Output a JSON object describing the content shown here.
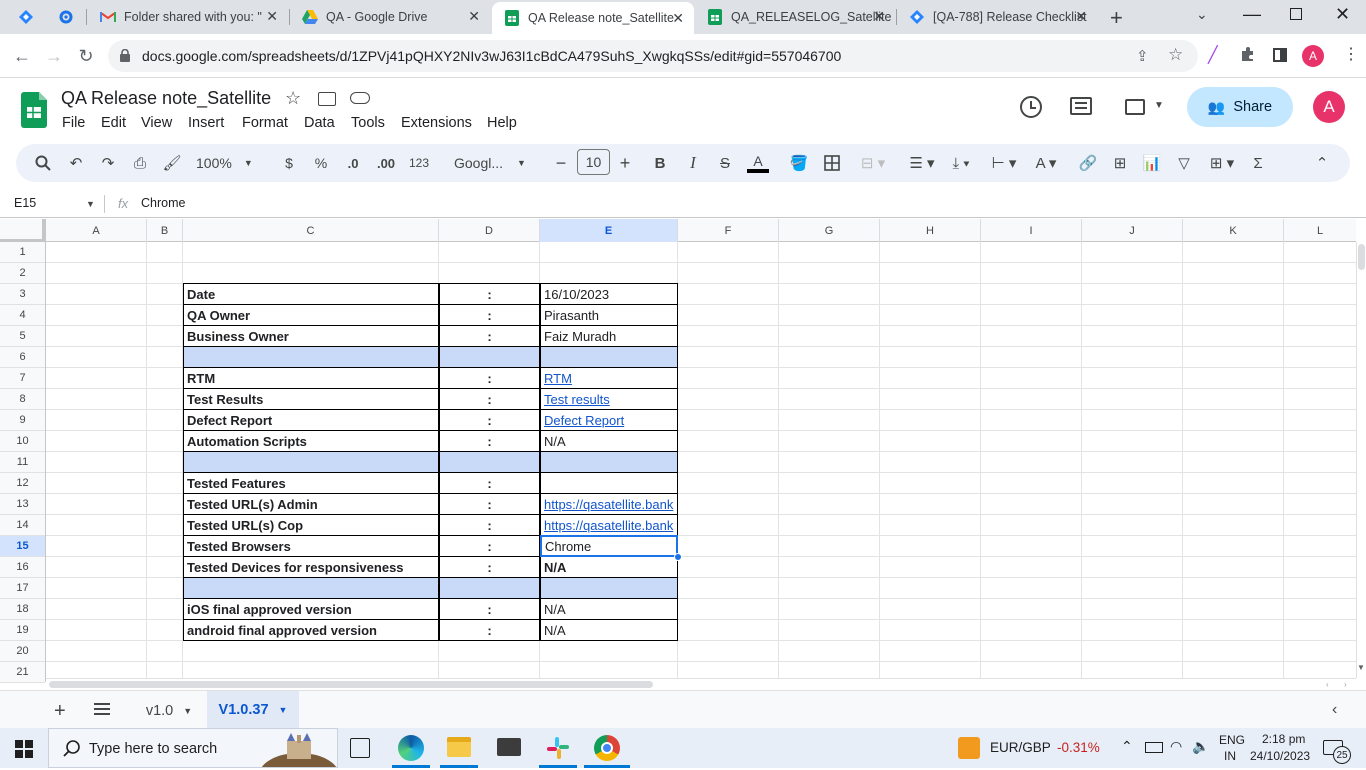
{
  "browser": {
    "tabs": [
      {
        "title": "Folder shared with you: \"",
        "icon": "gmail-icon"
      },
      {
        "title": "QA - Google Drive",
        "icon": "drive-icon"
      },
      {
        "title": "QA Release note_Satellite",
        "icon": "sheets-icon",
        "active": true
      },
      {
        "title": "QA_RELEASELOG_Satellite",
        "icon": "sheets-icon"
      },
      {
        "title": "[QA-788] Release Checklist",
        "icon": "jira-icon"
      }
    ],
    "url": "docs.google.com/spreadsheets/d/1ZPVj41pQHXY2NIv3wJ63I1cBdCA479SuhS_XwgkqSSs/edit#gid=557046700",
    "profile_initial": "A"
  },
  "doc": {
    "title": "QA Release note_Satellite",
    "menus": [
      "File",
      "Edit",
      "View",
      "Insert",
      "Format",
      "Data",
      "Tools",
      "Extensions",
      "Help"
    ],
    "share_label": "Share",
    "avatar_initial": "A"
  },
  "toolbar": {
    "zoom": "100%",
    "currency": "$",
    "percent": "%",
    "dec_decrease": ".0",
    "dec_increase": ".00",
    "number_format": "123",
    "font": "Googl...",
    "font_size": "10"
  },
  "formula_bar": {
    "cell_ref": "E15",
    "fx": "fx",
    "content": "Chrome"
  },
  "grid": {
    "columns": [
      "A",
      "B",
      "C",
      "D",
      "E",
      "F",
      "G",
      "H",
      "I",
      "J",
      "K",
      "L"
    ],
    "selected_column": "E",
    "rows": [
      "1",
      "2",
      "3",
      "4",
      "5",
      "6",
      "7",
      "8",
      "9",
      "10",
      "11",
      "12",
      "13",
      "14",
      "15",
      "16",
      "17",
      "18",
      "19",
      "20",
      "21"
    ],
    "selected_row": "15",
    "table": [
      {
        "row": 3,
        "label": "Date",
        "colon": ":",
        "value": "16/10/2023"
      },
      {
        "row": 4,
        "label": "QA Owner",
        "colon": ":",
        "value": "Pirasanth"
      },
      {
        "row": 5,
        "label": "Business Owner",
        "colon": ":",
        "value": "Faiz  Muradh"
      },
      {
        "row": 6,
        "label": "",
        "colon": "",
        "value": "",
        "separator": true
      },
      {
        "row": 7,
        "label": "RTM",
        "colon": ":",
        "value": "RTM",
        "link": true
      },
      {
        "row": 8,
        "label": "Test Results",
        "colon": ":",
        "value": "Test results",
        "link": true
      },
      {
        "row": 9,
        "label": "Defect Report",
        "colon": ":",
        "value": "Defect Report",
        "link": true
      },
      {
        "row": 10,
        "label": "Automation Scripts",
        "colon": ":",
        "value": "N/A"
      },
      {
        "row": 11,
        "label": "",
        "colon": "",
        "value": "",
        "separator": true
      },
      {
        "row": 12,
        "label": "Tested Features",
        "colon": ":",
        "value": ""
      },
      {
        "row": 13,
        "label": "Tested URL(s) Admin",
        "colon": ":",
        "value": "https://qasatellite.bank",
        "link": true
      },
      {
        "row": 14,
        "label": "Tested URL(s) Cop",
        "colon": ":",
        "value": "https://qasatellite.bank",
        "link": true
      },
      {
        "row": 15,
        "label": "Tested Browsers",
        "colon": ":",
        "value": "Chrome",
        "selected": true
      },
      {
        "row": 16,
        "label": "Tested Devices for responsiveness",
        "colon": ":",
        "value": "N/A",
        "bold": true
      },
      {
        "row": 17,
        "label": "",
        "colon": "",
        "value": "",
        "separator": true
      },
      {
        "row": 18,
        "label": "iOS final approved version",
        "colon": ":",
        "value": "N/A"
      },
      {
        "row": 19,
        "label": "android final approved version",
        "colon": ":",
        "value": "N/A"
      }
    ]
  },
  "sheets": [
    {
      "name": "v1.0",
      "active": false
    },
    {
      "name": "V1.0.37",
      "active": true
    }
  ],
  "taskbar": {
    "search_placeholder": "Type here to search",
    "ticker_label": "EUR/GBP",
    "ticker_change": "-0.31%",
    "lang_top": "ENG",
    "lang_bottom": "IN",
    "time": "2:18 pm",
    "date": "24/10/2023",
    "notifications": "25"
  },
  "colors": {
    "accent": "#0b57d0",
    "share_bg": "#c2e7ff",
    "separator_fill": "#c9daf8",
    "link": "#1155cc",
    "ticker_negative": "#c5221f"
  }
}
